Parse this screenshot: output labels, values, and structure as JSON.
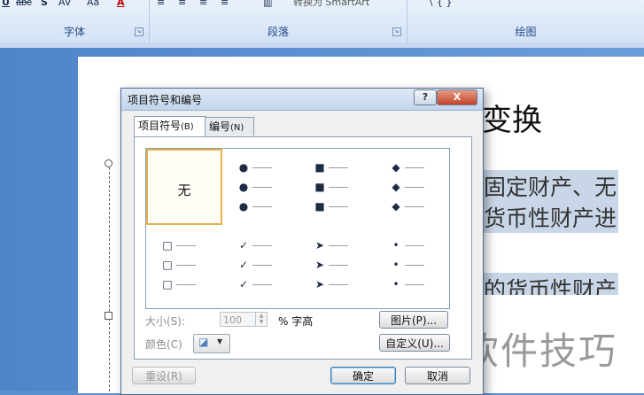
{
  "ribbon": {
    "font_group_label": "字体",
    "paragraph_group_label": "段落",
    "drawing_group_label": "绘图",
    "font_size_btn": "Aa",
    "strike_btn": "abc",
    "shadow_btn": "S",
    "spacing_btn": "AV",
    "font_color_btn": "A",
    "underline_btn": "U",
    "smartart_btn": "转换为 SmartArt"
  },
  "document": {
    "heading_fragment": "变换",
    "line1": "固定财产、无",
    "line2": "货币性财产进",
    "line3": "的货币性财产"
  },
  "watermark": "软件技巧",
  "dialog": {
    "title": "项目符号和编号",
    "help_symbol": "?",
    "close_symbol": "X",
    "tabs": [
      {
        "label": "项目符号",
        "hotkey": "(B)"
      },
      {
        "label": "编号",
        "hotkey": "(N)"
      }
    ],
    "gallery": {
      "none_label": "无",
      "bullets": [
        {
          "symbol": "●",
          "icon": "filled-circle-bullet"
        },
        {
          "symbol": "■",
          "icon": "filled-square-bullet"
        },
        {
          "symbol": "◆",
          "icon": "filled-diamond-bullet"
        },
        {
          "symbol": "□",
          "icon": "hollow-square-bullet"
        },
        {
          "symbol": "✓",
          "icon": "checkmark-bullet"
        },
        {
          "symbol": "➤",
          "icon": "arrow-bullet"
        },
        {
          "symbol": "•",
          "icon": "small-dot-bullet"
        }
      ]
    },
    "size_label": "大小(S):",
    "size_value": "100",
    "size_unit": "% 字高",
    "color_label": "颜色(C)",
    "picture_button": "图片(P)...",
    "customize_button": "自定义(U)...",
    "reset_button": "重设(R)",
    "ok_button": "确定",
    "cancel_button": "取消"
  }
}
